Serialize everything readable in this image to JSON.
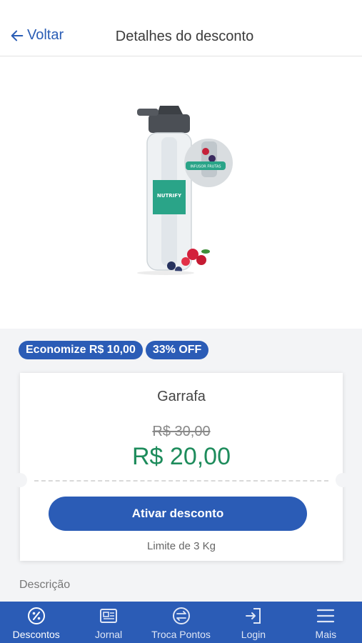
{
  "header": {
    "back_label": "Voltar",
    "title": "Detalhes do desconto"
  },
  "product_image": {
    "brand_text": "NUTRIFY",
    "sticker_text": "INFUSOR FRUTAS"
  },
  "badges": [
    "Economize R$ 10,00",
    "33% OFF"
  ],
  "card": {
    "name": "Garrafa",
    "old_price": "R$ 30,00",
    "new_price": "R$ 20,00",
    "cta": "Ativar desconto",
    "limit": "Limite de 3 Kg"
  },
  "description_label": "Descrição",
  "tabs": [
    {
      "label": "Descontos",
      "icon": "percent-icon",
      "active": true
    },
    {
      "label": "Jornal",
      "icon": "newspaper-icon",
      "active": false
    },
    {
      "label": "Troca Pontos",
      "icon": "exchange-icon",
      "active": false
    },
    {
      "label": "Login",
      "icon": "login-icon",
      "active": false
    },
    {
      "label": "Mais",
      "icon": "menu-icon",
      "active": false
    }
  ],
  "colors": {
    "primary": "#2b5cb6",
    "price_green": "#1e8c5c"
  }
}
